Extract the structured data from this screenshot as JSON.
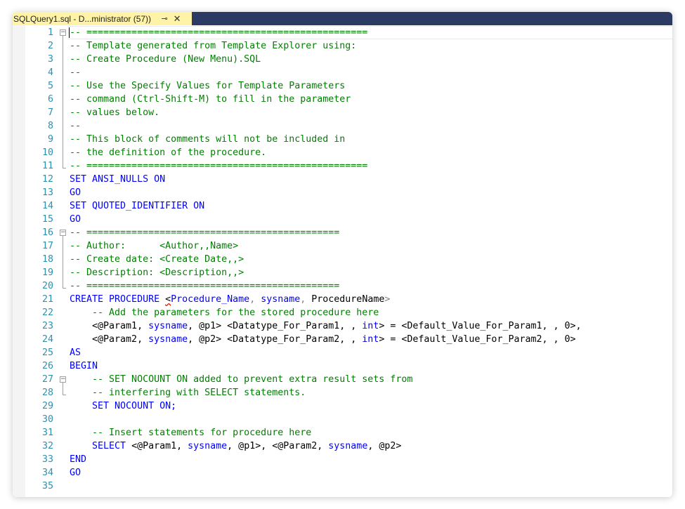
{
  "tab": {
    "title": "SQLQuery1.sql - D...ministrator (57))",
    "pin_glyph": "⊸",
    "close_glyph": "✕"
  },
  "editor": {
    "lines": [
      {
        "num": "1",
        "tokens": [
          {
            "t": "-- ==================================================",
            "c": "cm"
          }
        ]
      },
      {
        "num": "2",
        "tokens": [
          {
            "t": "-- Template generated from Template Explorer using:",
            "c": "cm"
          }
        ]
      },
      {
        "num": "3",
        "tokens": [
          {
            "t": "-- Create Procedure (New Menu).SQL",
            "c": "cm"
          }
        ]
      },
      {
        "num": "4",
        "tokens": [
          {
            "t": "--",
            "c": "cm"
          }
        ]
      },
      {
        "num": "5",
        "tokens": [
          {
            "t": "-- Use the Specify Values for Template Parameters",
            "c": "cm"
          }
        ]
      },
      {
        "num": "6",
        "tokens": [
          {
            "t": "-- command (Ctrl-Shift-M) to fill in the parameter",
            "c": "cm"
          }
        ]
      },
      {
        "num": "7",
        "tokens": [
          {
            "t": "-- values below.",
            "c": "cm"
          }
        ]
      },
      {
        "num": "8",
        "tokens": [
          {
            "t": "--",
            "c": "cm"
          }
        ]
      },
      {
        "num": "9",
        "tokens": [
          {
            "t": "-- This block of comments will not be included in",
            "c": "cm"
          }
        ]
      },
      {
        "num": "10",
        "tokens": [
          {
            "t": "-- the definition of the procedure.",
            "c": "cm"
          }
        ]
      },
      {
        "num": "11",
        "tokens": [
          {
            "t": "-- ==================================================",
            "c": "cm"
          }
        ]
      },
      {
        "num": "12",
        "tokens": [
          {
            "t": "SET ANSI_NULLS ON",
            "c": "kw"
          }
        ]
      },
      {
        "num": "13",
        "tokens": [
          {
            "t": "GO",
            "c": "kw"
          }
        ]
      },
      {
        "num": "14",
        "tokens": [
          {
            "t": "SET QUOTED_IDENTIFIER ON",
            "c": "kw"
          }
        ]
      },
      {
        "num": "15",
        "tokens": [
          {
            "t": "GO",
            "c": "kw"
          }
        ]
      },
      {
        "num": "16",
        "tokens": [
          {
            "t": "-- =============================================",
            "c": "cm"
          }
        ]
      },
      {
        "num": "17",
        "tokens": [
          {
            "t": "-- Author:      <Author,,Name>",
            "c": "cm"
          }
        ]
      },
      {
        "num": "18",
        "tokens": [
          {
            "t": "-- Create date: <Create Date,,>",
            "c": "cm"
          }
        ]
      },
      {
        "num": "19",
        "tokens": [
          {
            "t": "-- Description: <Description,,>",
            "c": "cm"
          }
        ]
      },
      {
        "num": "20",
        "tokens": [
          {
            "t": "-- =============================================",
            "c": "cm"
          }
        ]
      },
      {
        "num": "21",
        "tokens": [
          {
            "t": "CREATE PROCEDURE ",
            "c": "kw"
          },
          {
            "t": "<",
            "c": "sq"
          },
          {
            "t": "Procedure_Name",
            "c": "kw"
          },
          {
            "t": ", ",
            "c": "op"
          },
          {
            "t": "sysname",
            "c": "ty"
          },
          {
            "t": ", ",
            "c": "op"
          },
          {
            "t": "ProcedureName",
            "c": ""
          },
          {
            "t": ">",
            "c": "op"
          }
        ]
      },
      {
        "num": "22",
        "tokens": [
          {
            "t": "    -- Add the parameters for the stored procedure here",
            "c": "cm"
          }
        ]
      },
      {
        "num": "23",
        "tokens": [
          {
            "t": "    <@Param1, ",
            "c": ""
          },
          {
            "t": "sysname",
            "c": "ty"
          },
          {
            "t": ", @p1> <Datatype_For_Param1, , ",
            "c": ""
          },
          {
            "t": "int",
            "c": "ty"
          },
          {
            "t": "> = <Default_Value_For_Param1, , 0>,",
            "c": ""
          }
        ]
      },
      {
        "num": "24",
        "tokens": [
          {
            "t": "    <@Param2, ",
            "c": ""
          },
          {
            "t": "sysname",
            "c": "ty"
          },
          {
            "t": ", @p2> <Datatype_For_Param2, , ",
            "c": ""
          },
          {
            "t": "int",
            "c": "ty"
          },
          {
            "t": "> = <Default_Value_For_Param2, , 0>",
            "c": ""
          }
        ]
      },
      {
        "num": "25",
        "tokens": [
          {
            "t": "AS",
            "c": "kw"
          }
        ]
      },
      {
        "num": "26",
        "tokens": [
          {
            "t": "BEGIN",
            "c": "kw"
          }
        ]
      },
      {
        "num": "27",
        "tokens": [
          {
            "t": "    -- SET NOCOUNT ON added to prevent extra result sets from",
            "c": "cm"
          }
        ]
      },
      {
        "num": "28",
        "tokens": [
          {
            "t": "    -- interfering with SELECT statements.",
            "c": "cm"
          }
        ]
      },
      {
        "num": "29",
        "tokens": [
          {
            "t": "    SET NOCOUNT ON;",
            "c": "kw"
          }
        ]
      },
      {
        "num": "30",
        "tokens": []
      },
      {
        "num": "31",
        "tokens": [
          {
            "t": "    -- Insert statements for procedure here",
            "c": "cm"
          }
        ]
      },
      {
        "num": "32",
        "tokens": [
          {
            "t": "    SELECT ",
            "c": "kw"
          },
          {
            "t": "<@Param1, ",
            "c": ""
          },
          {
            "t": "sysname",
            "c": "ty"
          },
          {
            "t": ", @p1>, <@Param2, ",
            "c": ""
          },
          {
            "t": "sysname",
            "c": "ty"
          },
          {
            "t": ", @p2>",
            "c": ""
          }
        ]
      },
      {
        "num": "33",
        "tokens": [
          {
            "t": "END",
            "c": "kw"
          }
        ]
      },
      {
        "num": "34",
        "tokens": [
          {
            "t": "GO",
            "c": "kw"
          }
        ]
      },
      {
        "num": "35",
        "tokens": []
      }
    ]
  },
  "colors": {
    "tab_active": "#fff3a8",
    "tab_strip": "#2b3b63",
    "comment": "#008000",
    "keyword": "#0000ff",
    "line_number": "#2b91af"
  }
}
